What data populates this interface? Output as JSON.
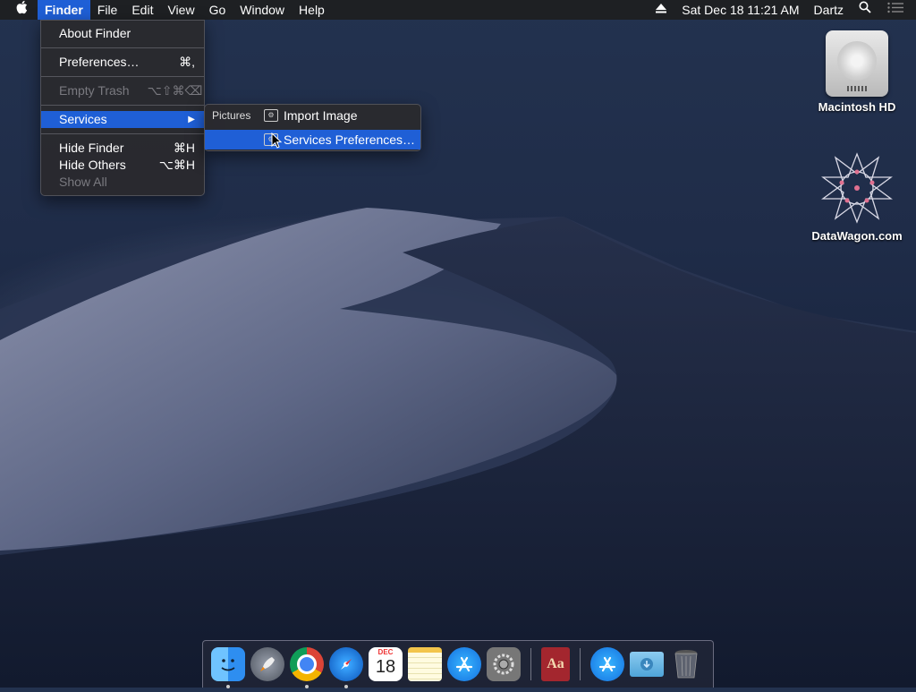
{
  "menubar": {
    "apple_glyph": "",
    "items": [
      "Finder",
      "File",
      "Edit",
      "View",
      "Go",
      "Window",
      "Help"
    ],
    "datetime": "Sat Dec 18  11:21 AM",
    "user": "Dartz"
  },
  "finder_menu": {
    "about": "About Finder",
    "preferences": "Preferences…",
    "preferences_shortcut": "⌘,",
    "empty_trash": "Empty Trash",
    "empty_trash_shortcut": "⌥⇧⌘⌫",
    "services": "Services",
    "services_arrow": "▶",
    "hide_finder": "Hide Finder",
    "hide_finder_shortcut": "⌘H",
    "hide_others": "Hide Others",
    "hide_others_shortcut": "⌥⌘H",
    "show_all": "Show All"
  },
  "services_submenu": {
    "category": "Pictures",
    "import_image": "Import Image",
    "services_preferences": "Services Preferences…"
  },
  "desktop": {
    "icons": [
      {
        "label": "Macintosh HD",
        "icon": "hard-drive-icon"
      },
      {
        "label": "DataWagon.com",
        "icon": "star-logo-icon"
      }
    ]
  },
  "dock": {
    "calendar_month": "DEC",
    "calendar_day": "18",
    "dictionary_label": "Aa"
  },
  "colors": {
    "highlight": "#1f5fd6",
    "menubar": "#1e1e20",
    "menu_bg": "#2a2a2e"
  }
}
